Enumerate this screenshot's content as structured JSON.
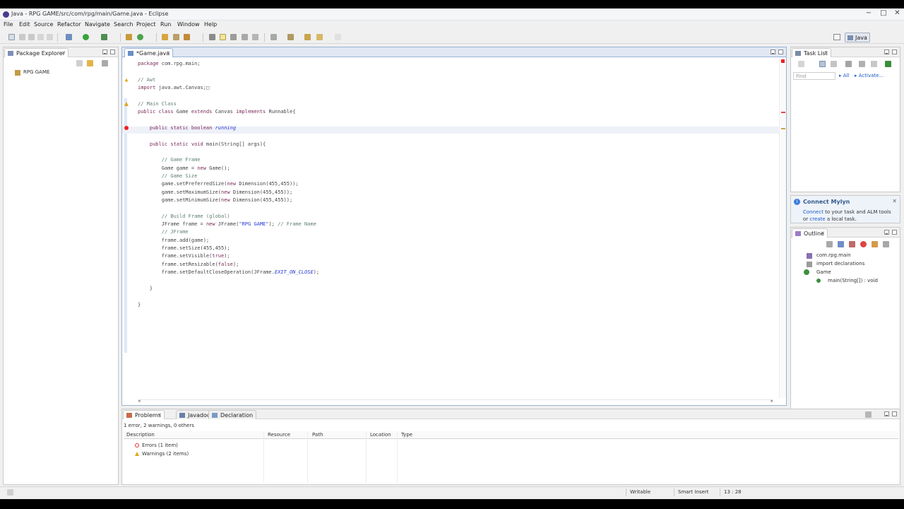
{
  "window": {
    "title": "Java - RPG GAME/src/com/rpg/main/Game.java - Eclipse",
    "minimize": "−",
    "maximize": "□",
    "close": "✕"
  },
  "menubar": [
    "File",
    "Edit",
    "Source",
    "Refactor",
    "Navigate",
    "Search",
    "Project",
    "Run",
    "Window",
    "Help"
  ],
  "toolbar": {
    "perspective_label": "Java"
  },
  "package_explorer": {
    "tab_label": "Package Explorer",
    "project": "RPG GAME"
  },
  "editor": {
    "tab_label": "*Game.java",
    "code_lines": [
      {
        "parts": [
          {
            "t": "package",
            "c": "kw"
          },
          {
            "t": " com.rpg.main;",
            "c": ""
          }
        ]
      },
      {
        "parts": []
      },
      {
        "parts": [
          {
            "t": "// Awt",
            "c": "cm"
          }
        ]
      },
      {
        "parts": [
          {
            "t": "import",
            "c": "kw"
          },
          {
            "t": " java.awt.Canvas;",
            "c": ""
          },
          {
            "t": "□",
            "c": ""
          }
        ]
      },
      {
        "parts": []
      },
      {
        "parts": [
          {
            "t": "// Main Class",
            "c": "cm"
          }
        ]
      },
      {
        "parts": [
          {
            "t": "public class",
            "c": "kw"
          },
          {
            "t": " Game ",
            "c": ""
          },
          {
            "t": "extends",
            "c": "kw"
          },
          {
            "t": " Canvas ",
            "c": ""
          },
          {
            "t": "implements",
            "c": "kw"
          },
          {
            "t": " Runnable{",
            "c": ""
          }
        ]
      },
      {
        "parts": []
      },
      {
        "parts": [
          {
            "t": "    public static boolean",
            "c": "kw"
          },
          {
            "t": " running",
            "c": "fld"
          }
        ]
      },
      {
        "parts": []
      },
      {
        "parts": [
          {
            "t": "    public static void",
            "c": "kw"
          },
          {
            "t": " main(String[] args){",
            "c": ""
          }
        ]
      },
      {
        "parts": []
      },
      {
        "parts": [
          {
            "t": "        // Game Frame",
            "c": "cm"
          }
        ]
      },
      {
        "parts": [
          {
            "t": "        Game game = ",
            "c": ""
          },
          {
            "t": "new",
            "c": "kw"
          },
          {
            "t": " Game();",
            "c": ""
          }
        ]
      },
      {
        "parts": [
          {
            "t": "        // Game Size",
            "c": "cm"
          }
        ]
      },
      {
        "parts": [
          {
            "t": "        game.setPreferredSize(",
            "c": ""
          },
          {
            "t": "new",
            "c": "kw"
          },
          {
            "t": " Dimension(455,455));",
            "c": ""
          }
        ]
      },
      {
        "parts": [
          {
            "t": "        game.setMaximumSize(",
            "c": ""
          },
          {
            "t": "new",
            "c": "kw"
          },
          {
            "t": " Dimension(455,455));",
            "c": ""
          }
        ]
      },
      {
        "parts": [
          {
            "t": "        game.setMinimumSize(",
            "c": ""
          },
          {
            "t": "new",
            "c": "kw"
          },
          {
            "t": " Dimension(455,455));",
            "c": ""
          }
        ]
      },
      {
        "parts": []
      },
      {
        "parts": [
          {
            "t": "        // Build Frame (global)",
            "c": "cm"
          }
        ]
      },
      {
        "parts": [
          {
            "t": "        JFrame frame = ",
            "c": ""
          },
          {
            "t": "new",
            "c": "kw"
          },
          {
            "t": " JFrame(",
            "c": ""
          },
          {
            "t": "\"RPG GAME\"",
            "c": "str"
          },
          {
            "t": "); ",
            "c": ""
          },
          {
            "t": "// Frame Name",
            "c": "cm"
          }
        ]
      },
      {
        "parts": [
          {
            "t": "        // JFrame",
            "c": "cm"
          }
        ]
      },
      {
        "parts": [
          {
            "t": "        frame.add(game);",
            "c": ""
          }
        ]
      },
      {
        "parts": [
          {
            "t": "        frame.setSize(455,455);",
            "c": ""
          }
        ]
      },
      {
        "parts": [
          {
            "t": "        frame.setVisible(",
            "c": ""
          },
          {
            "t": "true",
            "c": "kw"
          },
          {
            "t": ");",
            "c": ""
          }
        ]
      },
      {
        "parts": [
          {
            "t": "        frame.setResizable(",
            "c": ""
          },
          {
            "t": "false",
            "c": "kw"
          },
          {
            "t": ");",
            "c": ""
          }
        ]
      },
      {
        "parts": [
          {
            "t": "        frame.setDefaultCloseOperation(JFrame.",
            "c": ""
          },
          {
            "t": "EXIT_ON_CLOSE",
            "c": "fld"
          },
          {
            "t": ");",
            "c": ""
          }
        ]
      },
      {
        "parts": []
      },
      {
        "parts": [
          {
            "t": "    }",
            "c": ""
          }
        ]
      },
      {
        "parts": []
      },
      {
        "parts": [
          {
            "t": "}",
            "c": ""
          }
        ]
      }
    ]
  },
  "task_list": {
    "tab_label": "Task List",
    "find_placeholder": "Find",
    "filter_all": "All",
    "activate": "Activate..."
  },
  "mylyn": {
    "title": "Connect Mylyn",
    "connect_link": "Connect",
    "text_1": " to your task and ALM tools",
    "text_2": "or ",
    "create_link": "create",
    "text_3": " a local task."
  },
  "outline": {
    "tab_label": "Outline",
    "items": [
      "com.rpg.main",
      "import declarations",
      "Game",
      "main(String[]) : void"
    ]
  },
  "problems": {
    "tabs": [
      "Problems",
      "Javadoc",
      "Declaration"
    ],
    "summary": "1 error, 2 warnings, 0 others",
    "columns": [
      "Description",
      "Resource",
      "Path",
      "Location",
      "Type"
    ],
    "rows": [
      "Errors (1 item)",
      "Warnings (2 items)"
    ]
  },
  "statusbar": {
    "writable": "Writable",
    "insert_mode": "Smart Insert",
    "position": "13 : 28"
  }
}
